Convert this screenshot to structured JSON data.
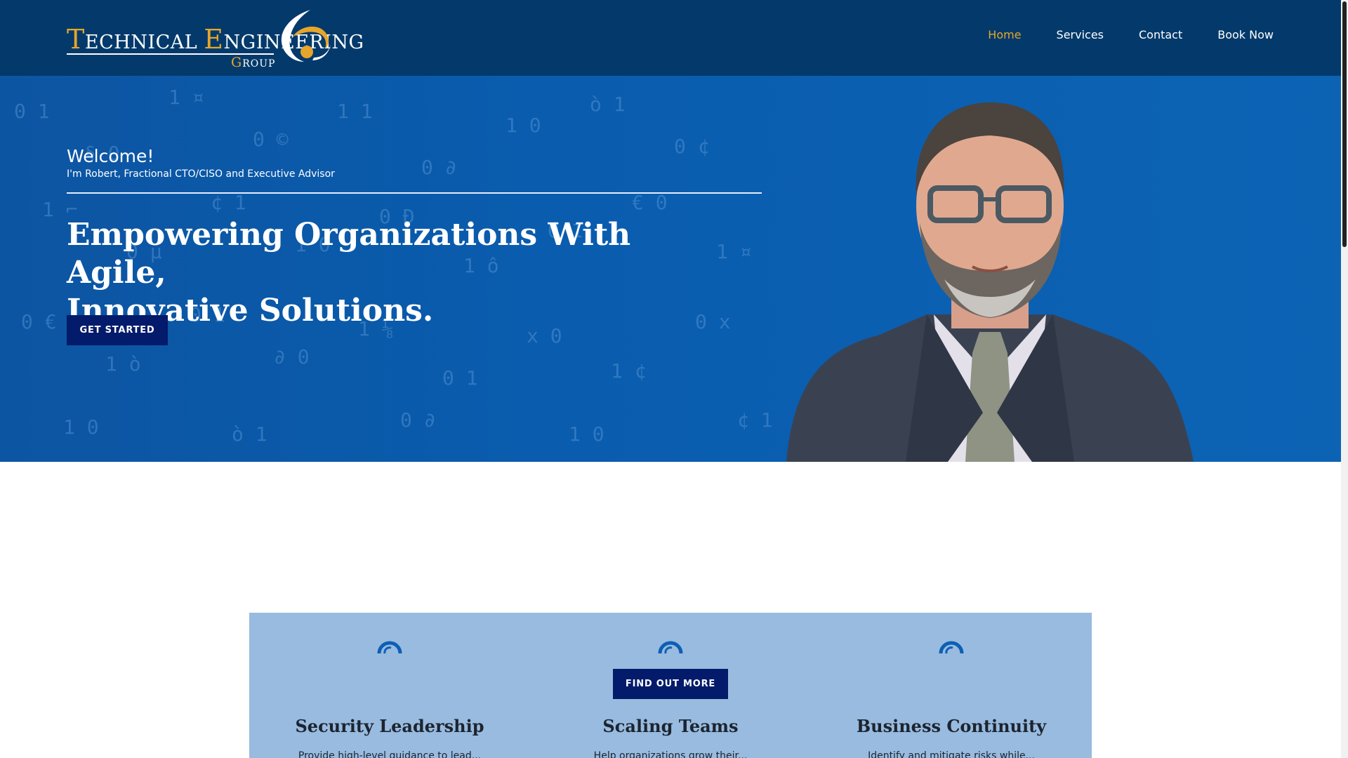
{
  "brand": {
    "logo_line1_initial1": "T",
    "logo_line1_rest1": "ECHNICAL",
    "logo_line1_initial2": "E",
    "logo_line1_rest2": "NGINEERING",
    "logo_line2_initial": "G",
    "logo_line2_rest": "ROUP",
    "accent_color": "#e7a52b",
    "header_color": "#033a6b"
  },
  "nav": {
    "items": [
      {
        "label": "Home",
        "active": true
      },
      {
        "label": "Services",
        "active": false
      },
      {
        "label": "Contact",
        "active": false
      },
      {
        "label": "Book Now",
        "active": false
      }
    ]
  },
  "hero": {
    "welcome": "Welcome!",
    "subline": "I'm Robert, Fractional CTO/CISO and Executive Advisor",
    "heading_line1": "Empowering Organizations With Agile,",
    "heading_line2": "Innovative Solutions.",
    "cta_label": "GET STARTED",
    "background_color": "#0a5cae"
  },
  "services": {
    "cta_label": "FIND OUT MORE",
    "panel_color": "#98bbdf",
    "items": [
      {
        "title": "Security Leadership",
        "icon": "arc-icon",
        "text": "Provide high-level guidance to lead..."
      },
      {
        "title": "Scaling Teams",
        "icon": "arc-icon",
        "text": "Help organizations grow their..."
      },
      {
        "title": "Business Continuity",
        "icon": "arc-icon",
        "text": "Identify and mitigate risks while..."
      }
    ]
  }
}
